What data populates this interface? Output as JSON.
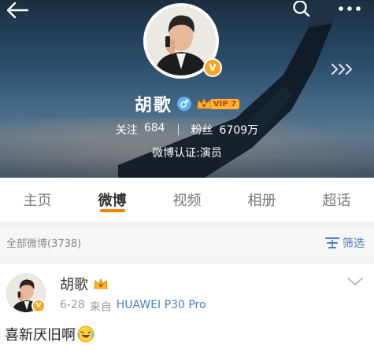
{
  "profile": {
    "name": "胡歌",
    "vip_level": "VIP 7",
    "following_label": "关注",
    "following_count": "684",
    "followers_label": "粉丝",
    "followers_count": "6709万",
    "verification": "微博认证:演员"
  },
  "tabs": [
    {
      "label": "主页",
      "active": false
    },
    {
      "label": "微博",
      "active": true
    },
    {
      "label": "视频",
      "active": false
    },
    {
      "label": "相册",
      "active": false
    },
    {
      "label": "超话",
      "active": false
    }
  ],
  "filter": {
    "title": "全部微博(3738)",
    "button_label": "筛选"
  },
  "post": {
    "author": "胡歌",
    "date": "6-28",
    "source_prefix": "来自",
    "source": "HUAWEI P30 Pro",
    "text": "喜新厌旧啊"
  },
  "icons": {
    "back": "back-arrow-icon",
    "search": "search-icon",
    "more": "more-dots-icon",
    "verified": "verified-v-icon",
    "gender": "male-icon",
    "crown": "crown-icon",
    "filter": "filter-icon",
    "post_menu": "chevron-down-icon",
    "emoji": "laughing-emoji-icon"
  },
  "colors": {
    "accent": "#ff8200",
    "link": "#4a7cc7",
    "verified": "#f5a623",
    "vip": "#ffb42b"
  }
}
